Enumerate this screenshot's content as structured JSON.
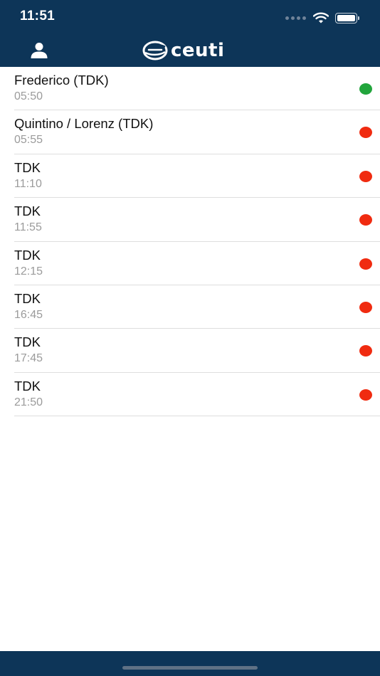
{
  "status_bar": {
    "time": "11:51"
  },
  "header": {
    "logo_text": "ceuti"
  },
  "colors": {
    "header_bg": "#0d3558",
    "online": "#22a53c",
    "offline": "#f02b10"
  },
  "rows": [
    {
      "title": "Frederico (TDK)",
      "time": "05:50",
      "status": "online"
    },
    {
      "title": "Quintino / Lorenz (TDK)",
      "time": "05:55",
      "status": "offline"
    },
    {
      "title": "TDK",
      "time": "11:10",
      "status": "offline"
    },
    {
      "title": "TDK",
      "time": "11:55",
      "status": "offline"
    },
    {
      "title": "TDK",
      "time": "12:15",
      "status": "offline"
    },
    {
      "title": "TDK",
      "time": "16:45",
      "status": "offline"
    },
    {
      "title": "TDK",
      "time": "17:45",
      "status": "offline"
    },
    {
      "title": "TDK",
      "time": "21:50",
      "status": "offline"
    }
  ]
}
